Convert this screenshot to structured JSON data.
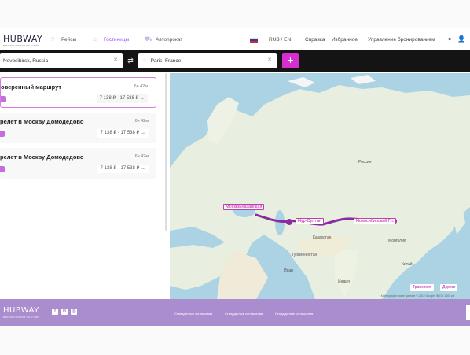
{
  "header": {
    "logo": "HUBWAY",
    "logo_sub": "BEST ROUTES FOR YOUR TRIP",
    "nav": [
      {
        "label": "Рейсы",
        "icon": "plane-icon"
      },
      {
        "label": "Гостиницы",
        "icon": "hotel-icon"
      },
      {
        "label": "Автопрокат",
        "icon": "car-icon"
      }
    ],
    "currency_lang": "RUB / EN",
    "help": "Справка",
    "favorites": "Избранное",
    "manage": "Управление бронированием",
    "login_icon": "login-icon",
    "user_icon": "user-icon"
  },
  "search": {
    "from": "Novosibirsk, Russia",
    "to": "Paris, France",
    "add_label": "+"
  },
  "routes": [
    {
      "title": "оверенный маршрут",
      "duration": "6ч 42м",
      "price": "7 138 ₽ - 17 538 ₽ →"
    },
    {
      "title": "релет в Москву Домодедово",
      "duration": "6ч 42м",
      "price": "7 138 ₽ - 17 538 ₽ →"
    },
    {
      "title": "релет в Москву Домодедово",
      "duration": "6ч 42м",
      "price": "7 138 ₽ - 17 538 ₽ →"
    }
  ],
  "map": {
    "cities": {
      "moscow": "Москва Казанская",
      "nursultan": "Нур-Султан",
      "novosibirsk": "Новосибирский Гл."
    },
    "labels": [
      "Казахстан",
      "Монголия",
      "Туркменистан",
      "Иран",
      "Индия",
      "Китай",
      "Россия"
    ],
    "buttons": [
      "Транспорт",
      "Дороги"
    ],
    "attribution": "Картографические данные © 2019 Google, INEGI   1000 км"
  },
  "footer": {
    "logo": "HUBWAY",
    "logo_sub": "BEST ROUTES FOR YOUR TRIP",
    "links": [
      "Стандартные соглашения",
      "Стандартные соглашения",
      "Стандартные соглашения"
    ],
    "social": [
      "f",
      "B",
      "◎"
    ]
  },
  "colors": {
    "accent": "#d62fd0",
    "route": "#8a2b9e",
    "footer": "#a98dcf",
    "searchbar": "#141414",
    "water": "#abd3e3"
  }
}
